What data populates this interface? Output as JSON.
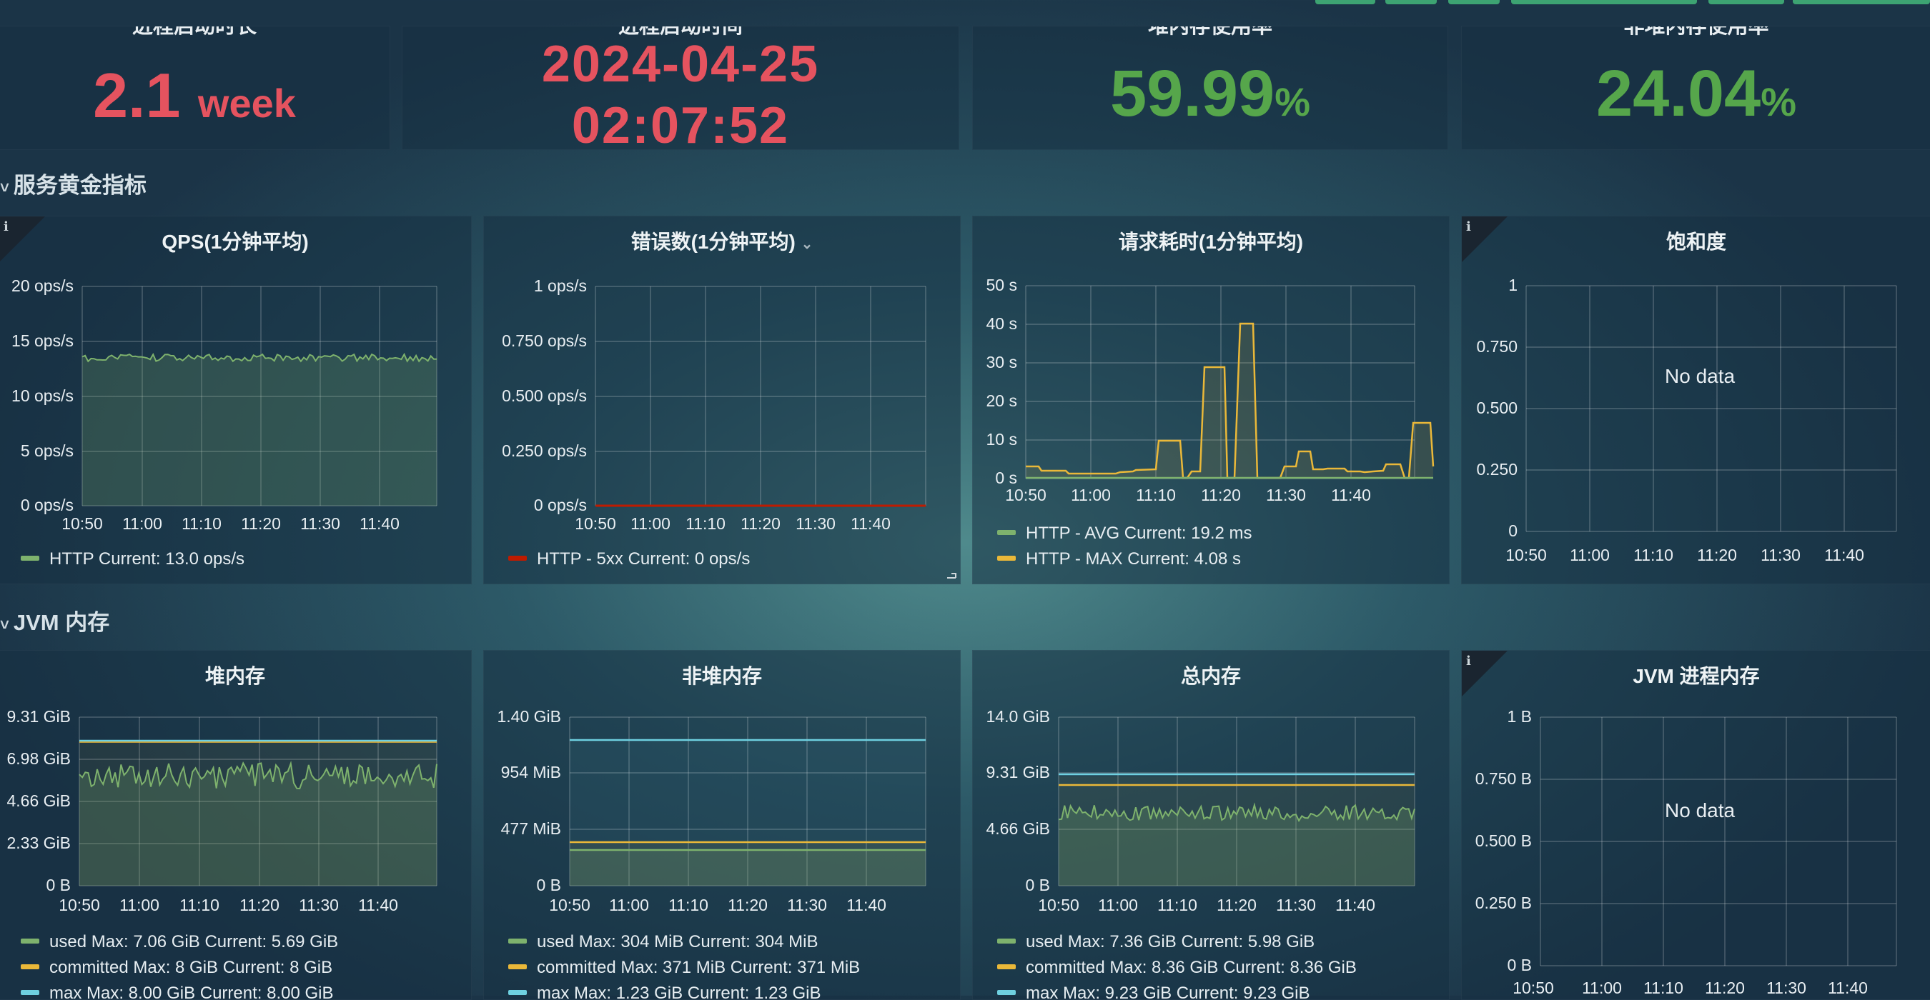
{
  "stats": [
    {
      "title": "进程启动时长",
      "value": "2.1",
      "unit": "week",
      "color": "#e5535f"
    },
    {
      "title": "进程启动时间",
      "value_line1": "2024-04-25",
      "value_line2": "02:07:52",
      "color": "#e5535f"
    },
    {
      "title": "堆内存使用率",
      "value": "59.99",
      "unit": "%",
      "color": "#56a64b"
    },
    {
      "title": "非堆内存使用率",
      "value": "24.04",
      "unit": "%",
      "color": "#56a64b"
    }
  ],
  "rows": [
    {
      "title": "服务黄金指标"
    },
    {
      "title": "JVM 内存"
    }
  ],
  "colors": {
    "green": "#7eb26d",
    "yellow": "#eab839",
    "cyan": "#6ed0e0",
    "red": "#bf1b00"
  },
  "x_ticks": [
    "10:50",
    "11:00",
    "11:10",
    "11:20",
    "11:30",
    "11:40"
  ],
  "panels": {
    "qps": {
      "title": "QPS(1分钟平均)",
      "y_ticks": [
        "20 ops/s",
        "15 ops/s",
        "10 ops/s",
        "5 ops/s",
        "0 ops/s"
      ],
      "legend": [
        {
          "label": "HTTP  Current: 13.0 ops/s",
          "color": "#7eb26d"
        }
      ]
    },
    "errors": {
      "title": "错误数(1分钟平均)",
      "y_ticks": [
        "1 ops/s",
        "0.750 ops/s",
        "0.500 ops/s",
        "0.250 ops/s",
        "0 ops/s"
      ],
      "legend": [
        {
          "label": "HTTP - 5xx  Current: 0 ops/s",
          "color": "#bf1b00"
        }
      ]
    },
    "latency": {
      "title": "请求耗时(1分钟平均)",
      "y_ticks": [
        "50 s",
        "40 s",
        "30 s",
        "20 s",
        "10 s",
        "0 s"
      ],
      "legend": [
        {
          "label": "HTTP - AVG  Current: 19.2 ms",
          "color": "#7eb26d"
        },
        {
          "label": "HTTP - MAX  Current: 4.08 s",
          "color": "#eab839"
        }
      ]
    },
    "saturation": {
      "title": "饱和度",
      "y_ticks": [
        "1",
        "0.750",
        "0.500",
        "0.250",
        "0"
      ],
      "no_data": "No data"
    },
    "heap": {
      "title": "堆内存",
      "y_ticks": [
        "9.31 GiB",
        "6.98 GiB",
        "4.66 GiB",
        "2.33 GiB",
        "0 B"
      ],
      "legend": [
        {
          "label": "used  Max: 7.06 GiB  Current: 5.69 GiB",
          "color": "#7eb26d"
        },
        {
          "label": "committed  Max: 8 GiB  Current: 8 GiB",
          "color": "#eab839"
        },
        {
          "label": "max  Max: 8.00 GiB  Current: 8.00 GiB",
          "color": "#6ed0e0"
        }
      ]
    },
    "nonheap": {
      "title": "非堆内存",
      "y_ticks": [
        "1.40 GiB",
        "954 MiB",
        "477 MiB",
        "0 B"
      ],
      "legend": [
        {
          "label": "used  Max: 304 MiB  Current: 304 MiB",
          "color": "#7eb26d"
        },
        {
          "label": "committed  Max: 371 MiB  Current: 371 MiB",
          "color": "#eab839"
        },
        {
          "label": "max  Max: 1.23 GiB  Current: 1.23 GiB",
          "color": "#6ed0e0"
        }
      ]
    },
    "total": {
      "title": "总内存",
      "y_ticks": [
        "14.0 GiB",
        "9.31 GiB",
        "4.66 GiB",
        "0 B"
      ],
      "legend": [
        {
          "label": "used  Max: 7.36 GiB  Current: 5.98 GiB",
          "color": "#7eb26d"
        },
        {
          "label": "committed  Max: 8.36 GiB  Current: 8.36 GiB",
          "color": "#eab839"
        },
        {
          "label": "max  Max: 9.23 GiB  Current: 9.23 GiB",
          "color": "#6ed0e0"
        }
      ]
    },
    "jvmproc": {
      "title": "JVM 进程内存",
      "y_ticks": [
        "1 B",
        "0.750 B",
        "0.500 B",
        "0.250 B",
        "0 B"
      ],
      "no_data": "No data"
    }
  },
  "chart_data": [
    {
      "type": "line",
      "title": "QPS(1分钟平均)",
      "ylim": [
        0,
        20
      ],
      "series": [
        {
          "name": "HTTP",
          "baseline": 13.3,
          "current": 13.0
        }
      ]
    },
    {
      "type": "line",
      "title": "错误数(1分钟平均)",
      "ylim": [
        0,
        1
      ],
      "series": [
        {
          "name": "HTTP - 5xx",
          "values": [
            0
          ]
        }
      ]
    },
    {
      "type": "line",
      "title": "请求耗时(1分钟平均)",
      "ylim": [
        0,
        50
      ],
      "series": [
        {
          "name": "HTTP - AVG",
          "values": [
            0.0192
          ]
        },
        {
          "name": "HTTP - MAX",
          "peaks": [
            10,
            29.5,
            42,
            8,
            4.5,
            15
          ]
        }
      ]
    },
    {
      "type": "line",
      "title": "堆内存",
      "ylim": [
        0,
        9.31
      ],
      "series": [
        {
          "name": "used",
          "max": 7.06,
          "current": 5.69
        },
        {
          "name": "committed",
          "max": 8,
          "current": 8
        },
        {
          "name": "max",
          "max": 8.0,
          "current": 8.0
        }
      ]
    },
    {
      "type": "line",
      "title": "非堆内存",
      "ylim": [
        0,
        1.4
      ],
      "series": [
        {
          "name": "used",
          "max": 0.297,
          "current": 0.297
        },
        {
          "name": "committed",
          "max": 0.362,
          "current": 0.362
        },
        {
          "name": "max",
          "max": 1.23,
          "current": 1.23
        }
      ]
    },
    {
      "type": "line",
      "title": "总内存",
      "ylim": [
        0,
        14.0
      ],
      "series": [
        {
          "name": "used",
          "max": 7.36,
          "current": 5.98
        },
        {
          "name": "committed",
          "max": 8.36,
          "current": 8.36
        },
        {
          "name": "max",
          "max": 9.23,
          "current": 9.23
        }
      ]
    }
  ]
}
